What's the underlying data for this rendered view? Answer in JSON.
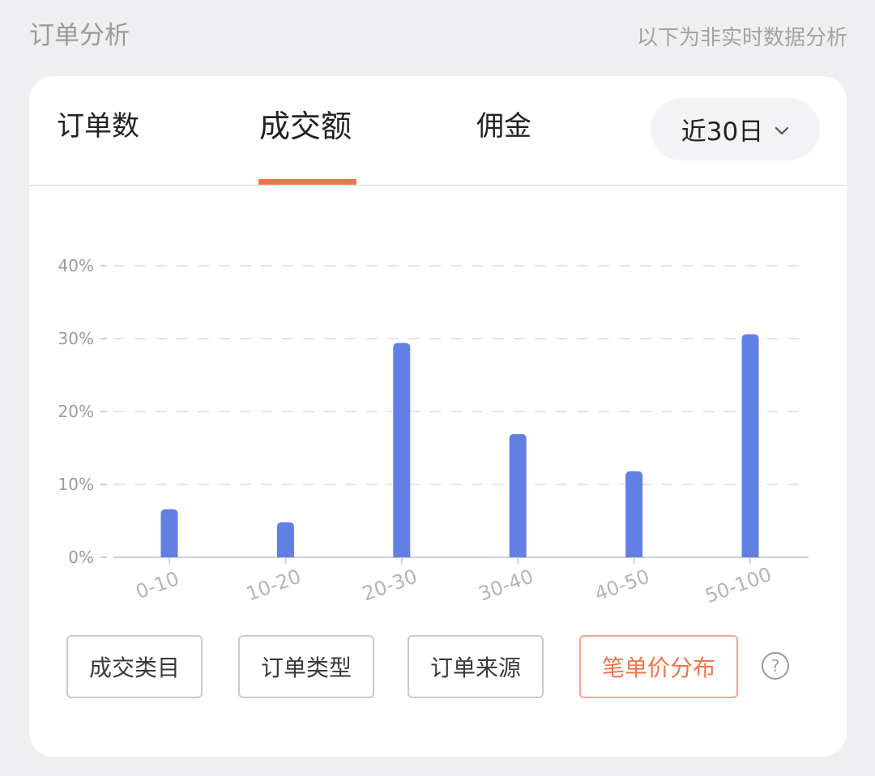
{
  "header": {
    "title": "订单分析",
    "note": "以下为非实时数据分析"
  },
  "tabs": [
    {
      "label": "订单数",
      "active": false
    },
    {
      "label": "成交额",
      "active": true
    },
    {
      "label": "佣金",
      "active": false
    }
  ],
  "period": {
    "label": "近30日",
    "icon": "chevron-down-icon"
  },
  "filters": [
    {
      "label": "成交类目",
      "active": false
    },
    {
      "label": "订单类型",
      "active": false
    },
    {
      "label": "订单来源",
      "active": false
    },
    {
      "label": "笔单价分布",
      "active": true
    }
  ],
  "help": {
    "icon": "question-circle-icon",
    "glyph": "?"
  },
  "colors": {
    "accent": "#f0764a",
    "bar": "#6280e3",
    "gridline": "#e5e5e8",
    "axis": "#cfcfd3",
    "tick_text": "#9a9a9a"
  },
  "chart_data": {
    "type": "bar",
    "categories": [
      "0-10",
      "10-20",
      "20-30",
      "30-40",
      "40-50",
      "50-100"
    ],
    "values": [
      6.6,
      4.8,
      29.4,
      16.9,
      11.8,
      30.6
    ],
    "yticks": [
      "0%",
      "10%",
      "20%",
      "30%",
      "40%"
    ],
    "ylim": [
      0,
      40
    ],
    "ylabel": "",
    "xlabel": "",
    "grid": true,
    "gridline_style": "dashed"
  }
}
